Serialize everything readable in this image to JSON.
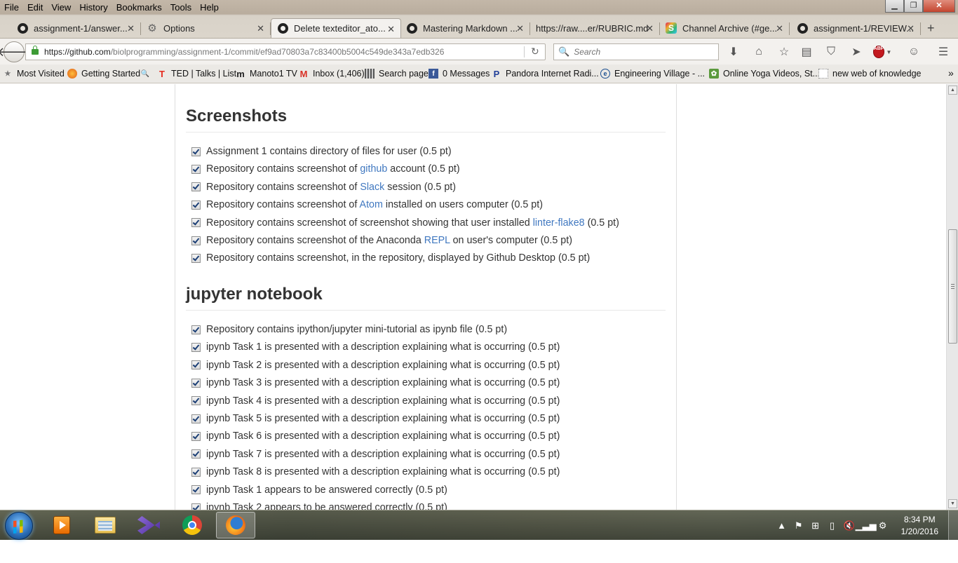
{
  "menus": [
    "File",
    "Edit",
    "View",
    "History",
    "Bookmarks",
    "Tools",
    "Help"
  ],
  "tabs": [
    {
      "title": "assignment-1/answer...",
      "icon": "github-icon",
      "active": false
    },
    {
      "title": "Options",
      "icon": "gear-icon",
      "active": false
    },
    {
      "title": "Delete texteditor_ato...",
      "icon": "github-icon",
      "active": true
    },
    {
      "title": "Mastering Markdown ...",
      "icon": "github-icon",
      "active": false
    },
    {
      "title": "https://raw....er/RUBRIC.md",
      "icon": "none",
      "active": false
    },
    {
      "title": "Channel Archive (#ge...",
      "icon": "slack-icon",
      "active": false
    },
    {
      "title": "assignment-1/REVIEW...",
      "icon": "github-icon",
      "active": false
    }
  ],
  "url": {
    "host": "https://github.com",
    "path": "/biolprogramming/assignment-1/commit/ef9ad70803a7c83400b5004c549de343a7edb326"
  },
  "search": {
    "placeholder": "Search"
  },
  "bookmarks": [
    {
      "label": "Most Visited",
      "icon": "star-icon"
    },
    {
      "label": "Getting Started",
      "icon": "firefox-icon"
    },
    {
      "label": "",
      "icon": "search-icon"
    },
    {
      "label": "TED | Talks | List",
      "icon": "ted-icon"
    },
    {
      "label": "Manoto1 TV",
      "icon": "manoto-icon"
    },
    {
      "label": "Inbox (1,406)",
      "icon": "gmail-icon"
    },
    {
      "label": "Search page",
      "icon": "library-icon"
    },
    {
      "label": "0 Messages",
      "icon": "facebook-icon"
    },
    {
      "label": "Pandora Internet Radi...",
      "icon": "pandora-icon"
    },
    {
      "label": "Engineering Village - ...",
      "icon": "ev-icon"
    },
    {
      "label": "Online Yoga Videos, St...",
      "icon": "yoga-icon"
    },
    {
      "label": "new web of knowledge",
      "icon": "page-icon"
    }
  ],
  "sections": [
    {
      "heading": "Screenshots",
      "items": [
        [
          {
            "t": "Assignment 1 contains directory of files for user (0.5 pt)"
          }
        ],
        [
          {
            "t": "Repository contains screenshot of "
          },
          {
            "t": "github",
            "link": true
          },
          {
            "t": " account (0.5 pt)"
          }
        ],
        [
          {
            "t": "Repository contains screenshot of "
          },
          {
            "t": "Slack",
            "link": true
          },
          {
            "t": " session (0.5 pt)"
          }
        ],
        [
          {
            "t": "Repository contains screenshot of "
          },
          {
            "t": "Atom",
            "link": true
          },
          {
            "t": " installed on users computer (0.5 pt)"
          }
        ],
        [
          {
            "t": "Repository contains screenshot of screenshot showing that user installed "
          },
          {
            "t": "linter-flake8",
            "link": true
          },
          {
            "t": " (0.5 pt)"
          }
        ],
        [
          {
            "t": "Repository contains screenshot of the Anaconda "
          },
          {
            "t": "REPL",
            "link": true
          },
          {
            "t": " on user's computer (0.5 pt)"
          }
        ],
        [
          {
            "t": "Repository contains screenshot, in the repository, displayed by Github Desktop (0.5 pt)"
          }
        ]
      ]
    },
    {
      "heading": "jupyter notebook",
      "items": [
        [
          {
            "t": "Repository contains ipython/jupyter mini-tutorial as ipynb file (0.5 pt)"
          }
        ],
        [
          {
            "t": "ipynb Task 1 is presented with a description explaining what is occurring (0.5 pt)"
          }
        ],
        [
          {
            "t": "ipynb Task 2 is presented with a description explaining what is occurring (0.5 pt)"
          }
        ],
        [
          {
            "t": "ipynb Task 3 is presented with a description explaining what is occurring (0.5 pt)"
          }
        ],
        [
          {
            "t": "ipynb Task 4 is presented with a description explaining what is occurring (0.5 pt)"
          }
        ],
        [
          {
            "t": "ipynb Task 5 is presented with a description explaining what is occurring (0.5 pt)"
          }
        ],
        [
          {
            "t": "ipynb Task 6 is presented with a description explaining what is occurring (0.5 pt)"
          }
        ],
        [
          {
            "t": "ipynb Task 7 is presented with a description explaining what is occurring (0.5 pt)"
          }
        ],
        [
          {
            "t": "ipynb Task 8 is presented with a description explaining what is occurring (0.5 pt)"
          }
        ],
        [
          {
            "t": "ipynb Task 1 appears to be answered correctly (0.5 pt)"
          }
        ],
        [
          {
            "t": "ipynb Task 2 appears to be answered correctly (0.5 pt)"
          }
        ]
      ]
    }
  ],
  "taskbar": {
    "apps": [
      "windows-media-player-icon",
      "windows-explorer-icon",
      "visual-studio-icon",
      "chrome-icon",
      "firefox-icon"
    ],
    "active_app": "firefox-icon",
    "time": "8:34 PM",
    "date": "1/20/2016"
  },
  "colors": {
    "link": "#4078c0",
    "text": "#333333",
    "heading": "#333333"
  }
}
